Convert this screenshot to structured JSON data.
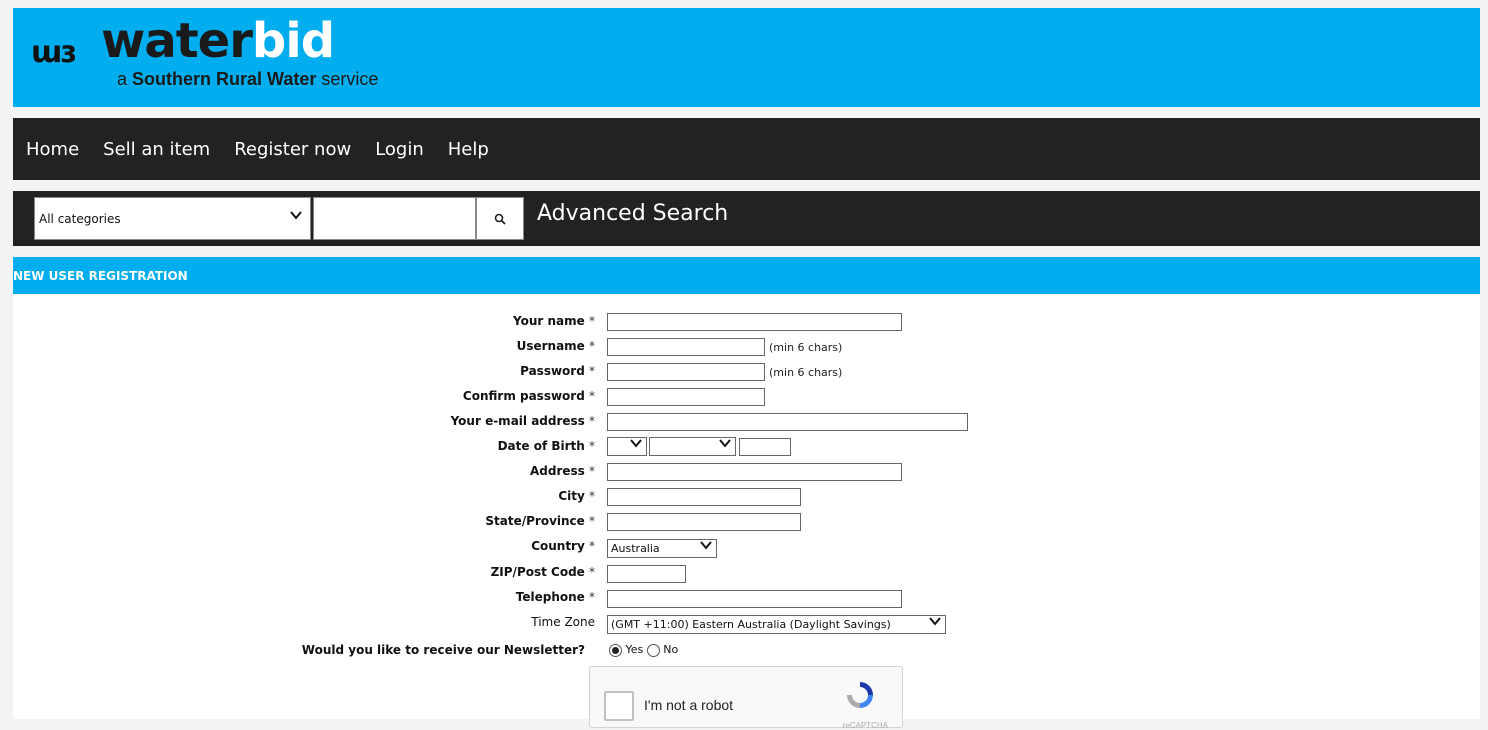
{
  "header": {
    "logo_mark": "ɯɜ",
    "logo_word_1": "water",
    "logo_word_2": "bid",
    "tagline_prefix": "a ",
    "tagline_bold": "Southern Rural Water",
    "tagline_suffix": " service",
    "brand_color": "#00adee"
  },
  "nav": {
    "items": [
      "Home",
      "Sell an item",
      "Register now",
      "Login",
      "Help"
    ]
  },
  "search": {
    "category_value": "All categories",
    "query_value": "",
    "advanced_label": "Advanced Search"
  },
  "section": {
    "title": "NEW USER REGISTRATION"
  },
  "form": {
    "required_mark": "*",
    "your_name": "Your name",
    "username": "Username",
    "username_note": "(min 6 chars)",
    "password": "Password",
    "password_note": "(min 6 chars)",
    "confirm_password": "Confirm password",
    "email": "Your e-mail address",
    "dob": "Date of Birth",
    "address": "Address",
    "city": "City",
    "state": "State/Province",
    "country": "Country",
    "country_value": "Australia",
    "zip": "ZIP/Post Code",
    "telephone": "Telephone",
    "timezone": "Time Zone",
    "timezone_value": "(GMT +11:00) Eastern Australia (Daylight Savings)",
    "newsletter": "Would you like to receive our Newsletter?",
    "newsletter_yes": "Yes",
    "newsletter_no": "No"
  },
  "captcha": {
    "label": "I'm not a robot",
    "brand": "reCAPTCHA"
  }
}
